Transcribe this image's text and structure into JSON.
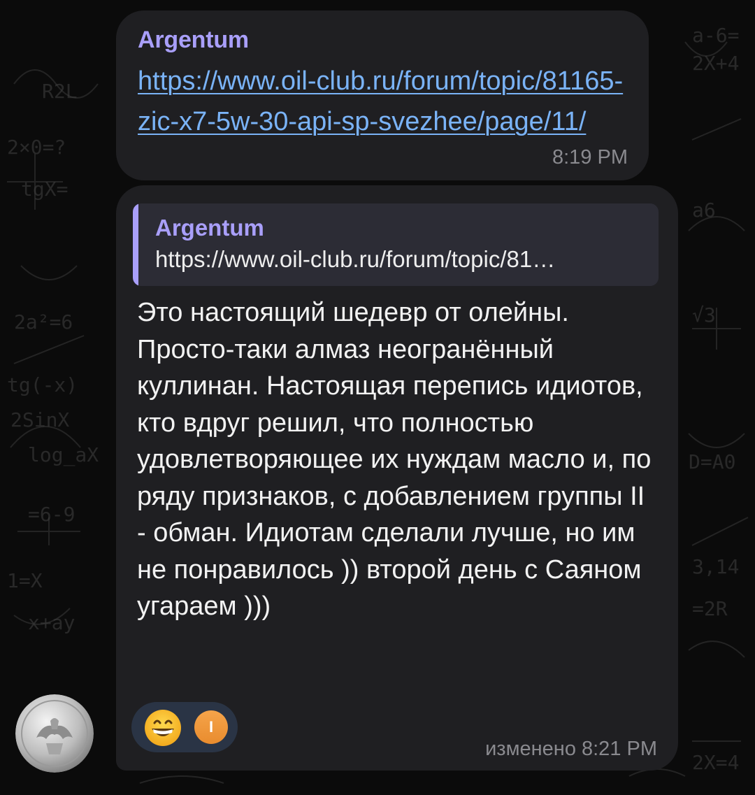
{
  "messages": [
    {
      "sender": "Argentum",
      "link": "https://www.oil-club.ru/forum/topic/81165-zic-x7-5w-30-api-sp-svezhee/page/11/",
      "time": "8:19 PM"
    },
    {
      "reply": {
        "sender": "Argentum",
        "text": "https://www.oil-club.ru/forum/topic/81…"
      },
      "text": "Это настоящий шедевр от олейны. Просто-таки алмаз неогранённый куллинан. Настоящая перепись идиотов, кто вдруг решил, что полностью удовлетворяющее их нуждам масло и, по ряду признаков, с добавлением группы II - обман. Идиотам сделали лучше, но им не понравилось )) второй день с Саяном угараем )))",
      "reactions": [
        {
          "icon": "grinning-face-emoji",
          "reactor_initial": "I"
        }
      ],
      "time": "изменено 8:21 PM"
    }
  ],
  "colors": {
    "bubble": "#1f1f22",
    "sender": "#a99ffa",
    "link": "#7ab3f7",
    "quote_bg": "#2c2c35",
    "reaction_bg": "#2a3445",
    "meta": "#8a8a8f"
  }
}
